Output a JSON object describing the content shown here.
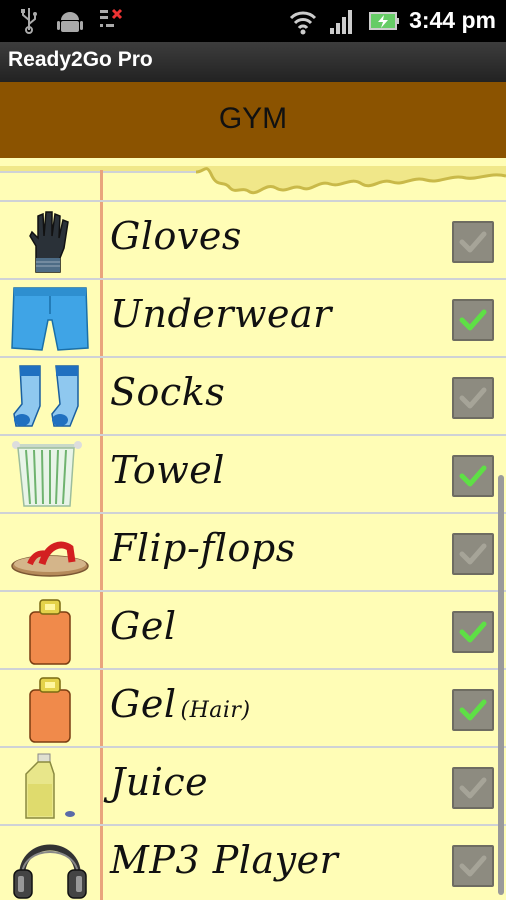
{
  "status_bar": {
    "time": "3:44 pm",
    "icons": [
      "usb-icon",
      "android-debug-icon",
      "sync-error-icon",
      "wifi-icon",
      "signal-icon",
      "battery-charging-icon"
    ]
  },
  "app": {
    "title": "Ready2Go Pro"
  },
  "header": {
    "category": "GYM"
  },
  "items": [
    {
      "label": "Gloves",
      "sublabel": "",
      "checked": false,
      "icon": "gloves-icon"
    },
    {
      "label": "Underwear",
      "sublabel": "",
      "checked": true,
      "icon": "underwear-icon"
    },
    {
      "label": "Socks",
      "sublabel": "",
      "checked": false,
      "icon": "socks-icon"
    },
    {
      "label": "Towel",
      "sublabel": "",
      "checked": true,
      "icon": "towel-icon"
    },
    {
      "label": "Flip-flops",
      "sublabel": "",
      "checked": false,
      "icon": "flip-flops-icon"
    },
    {
      "label": "Gel",
      "sublabel": "",
      "checked": true,
      "icon": "gel-bottle-icon"
    },
    {
      "label": "Gel",
      "sublabel": "(Hair)",
      "checked": true,
      "icon": "gel-bottle-icon"
    },
    {
      "label": "Juice",
      "sublabel": "",
      "checked": false,
      "icon": "juice-bottle-icon"
    },
    {
      "label": "MP3 Player",
      "sublabel": "",
      "checked": false,
      "icon": "headphones-icon"
    }
  ],
  "colors": {
    "header_bg": "#8b5300",
    "paper_bg": "#fffdb6",
    "margin_line": "#e9a47c",
    "check_on": "#5ee045",
    "check_off": "#a6a498",
    "checkbox_bg": "#8d8b80"
  }
}
